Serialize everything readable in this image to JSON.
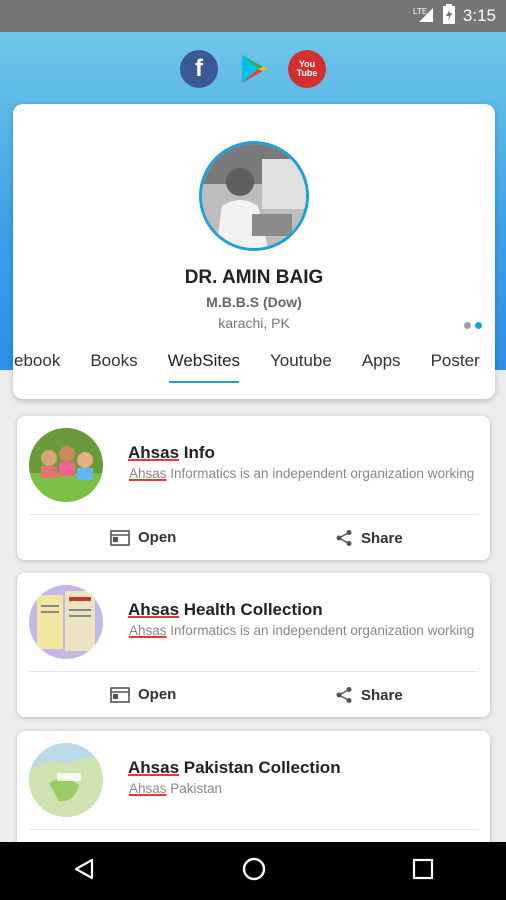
{
  "status_bar": {
    "network": "LTE",
    "time": "3:15"
  },
  "social": [
    "facebook-icon",
    "google-play-icon",
    "youtube-icon"
  ],
  "profile": {
    "name": "DR. AMIN BAIG",
    "degree": "M.B.B.S (Dow)",
    "location": "karachi, PK"
  },
  "tabs": [
    "ebook",
    "Books",
    "WebSites",
    "Youtube",
    "Apps",
    "Poster"
  ],
  "active_tab": "WebSites",
  "cards": [
    {
      "title_prefix": "Ahsas",
      "title_rest": " Info",
      "desc_prefix": "Ahsas",
      "desc_rest": " Informatics is an independent organization working",
      "open": "Open",
      "share": "Share"
    },
    {
      "title_prefix": "Ahsas",
      "title_rest": " Health Collection",
      "desc_prefix": "Ahsas",
      "desc_rest": " Informatics is an independent organization working",
      "open": "Open",
      "share": "Share"
    },
    {
      "title_prefix": "Ahsas",
      "title_rest": " Pakistan Collection",
      "desc_prefix": "Ahsas",
      "desc_rest": " Pakistan"
    }
  ],
  "accent_color": "#1da1d8"
}
